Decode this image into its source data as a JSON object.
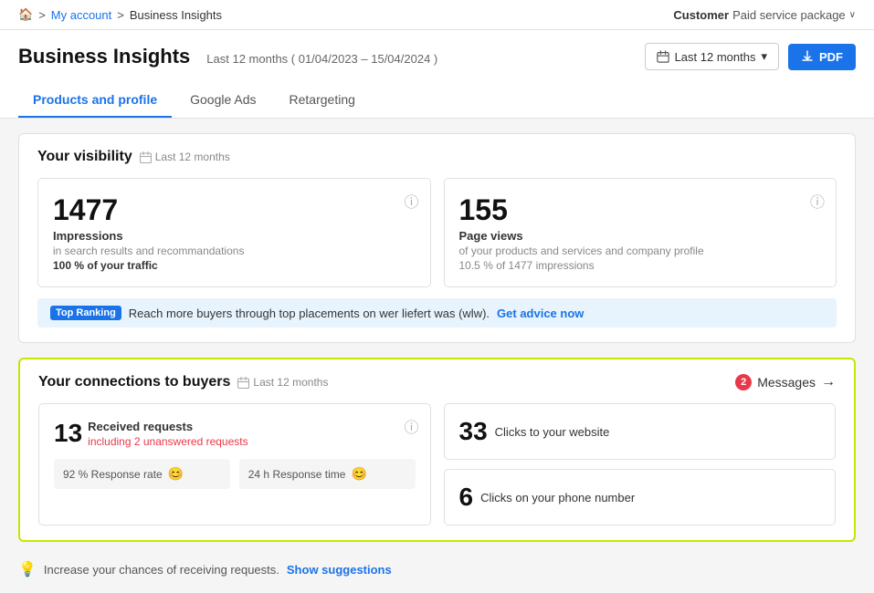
{
  "breadcrumb": {
    "home_icon": "🏠",
    "my_account": "My account",
    "separator1": ">",
    "current": "Business Insights"
  },
  "topbar": {
    "customer_label": "Customer",
    "package_label": "Paid service package",
    "chevron": "∨"
  },
  "header": {
    "title": "Business Insights",
    "subtitle": "Last 12 months ( 01/04/2023 – 15/04/2024 )",
    "date_filter_label": "Last 12 months",
    "pdf_label": "PDF"
  },
  "tabs": [
    {
      "id": "products",
      "label": "Products and profile",
      "active": true
    },
    {
      "id": "google_ads",
      "label": "Google Ads",
      "active": false
    },
    {
      "id": "retargeting",
      "label": "Retargeting",
      "active": false
    }
  ],
  "visibility": {
    "section_title": "Your visibility",
    "period": "Last 12 months",
    "impressions": {
      "number": "1477",
      "label": "Impressions",
      "sublabel": "in search results and recommandations",
      "highlight": "100 % of your traffic"
    },
    "page_views": {
      "number": "155",
      "label": "Page views",
      "sublabel": "of your products and services and company profile",
      "highlight": "10.5 % of 1477 impressions"
    }
  },
  "banner": {
    "badge": "Top Ranking",
    "text": "Reach more buyers through top placements on  wer liefert was (wlw).",
    "link": "Get advice now"
  },
  "connections": {
    "section_title": "Your connections to buyers",
    "period": "Last 12 months",
    "messages_badge": "2",
    "messages_label": "Messages",
    "received": {
      "number": "13",
      "label": "Received requests",
      "sublabel": "including 2 unanswered requests"
    },
    "response_rate": {
      "value": "92 % Response rate",
      "emoji": "😊"
    },
    "response_time": {
      "value": "24 h Response time",
      "emoji": "😊"
    },
    "clicks_website": {
      "number": "33",
      "label": "Clicks to your website"
    },
    "clicks_phone": {
      "number": "6",
      "label": "Clicks on your phone number"
    }
  },
  "suggestions": {
    "text": "Increase your chances of receiving requests.",
    "link": "Show suggestions"
  }
}
